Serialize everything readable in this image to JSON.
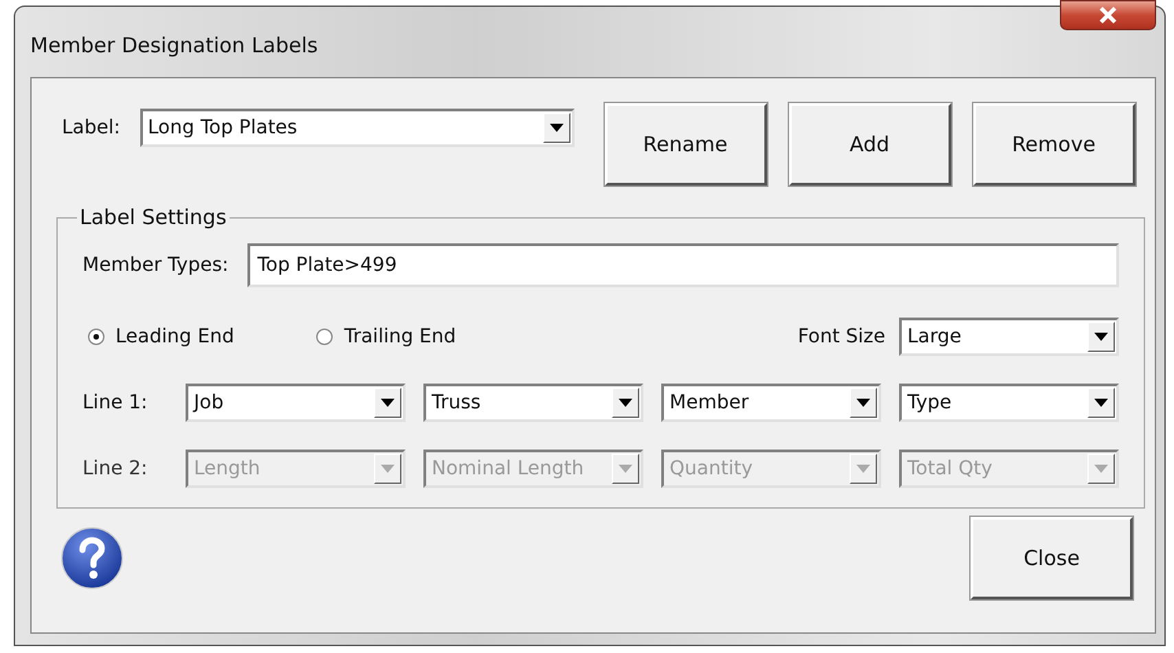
{
  "window": {
    "title": "Member Designation Labels"
  },
  "label": {
    "caption": "Label:",
    "value": "Long Top Plates"
  },
  "buttons": [
    "Rename",
    "Add",
    "Remove"
  ],
  "settings": {
    "title": "Label Settings",
    "member_types": {
      "caption": "Member Types:",
      "value": "Top Plate>499"
    },
    "ends": [
      {
        "label": "Leading End",
        "selected": true
      },
      {
        "label": "Trailing End",
        "selected": false
      }
    ],
    "font_size": {
      "caption": "Font Size",
      "value": "Large"
    },
    "lines": [
      {
        "caption": "Line 1:",
        "disabled": false,
        "fields": [
          "Job",
          "Truss",
          "Member",
          "Type"
        ]
      },
      {
        "caption": "Line 2:",
        "disabled": true,
        "fields": [
          "Length",
          "Nominal Length",
          "Quantity",
          "Total Qty"
        ]
      }
    ]
  },
  "close_button": "Close"
}
